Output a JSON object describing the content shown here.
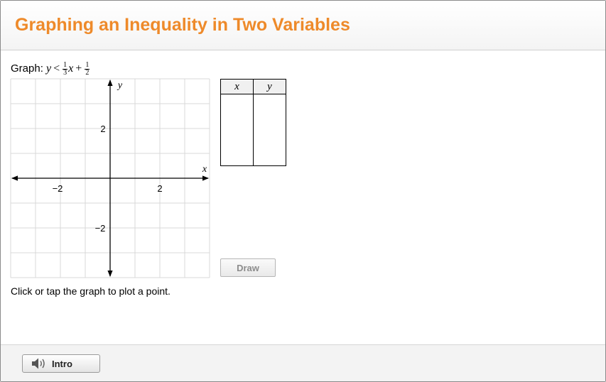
{
  "header": {
    "title": "Graphing an Inequality in Two Variables"
  },
  "prompt": {
    "label": "Graph:",
    "lhs": "y",
    "operator": "<",
    "coef_num": "1",
    "coef_den": "3",
    "var": "x",
    "plus": "+",
    "const_num": "1",
    "const_den": "2"
  },
  "graph": {
    "x_axis_label": "x",
    "y_axis_label": "y",
    "x_tick_labels": [
      "−2",
      "2"
    ],
    "y_tick_labels": [
      "2",
      "−2"
    ],
    "x_range": [
      -4,
      4
    ],
    "y_range": [
      -4,
      4
    ],
    "grid": true
  },
  "table": {
    "headers": [
      "x",
      "y"
    ]
  },
  "draw_button": {
    "label": "Draw"
  },
  "instruction": "Click or tap the graph to plot a point.",
  "footer": {
    "intro_label": "Intro",
    "intro_icon": "speaker-icon"
  },
  "colors": {
    "title": "#ee8a2a",
    "grid": "#d9d9d9",
    "axis": "#000000"
  }
}
